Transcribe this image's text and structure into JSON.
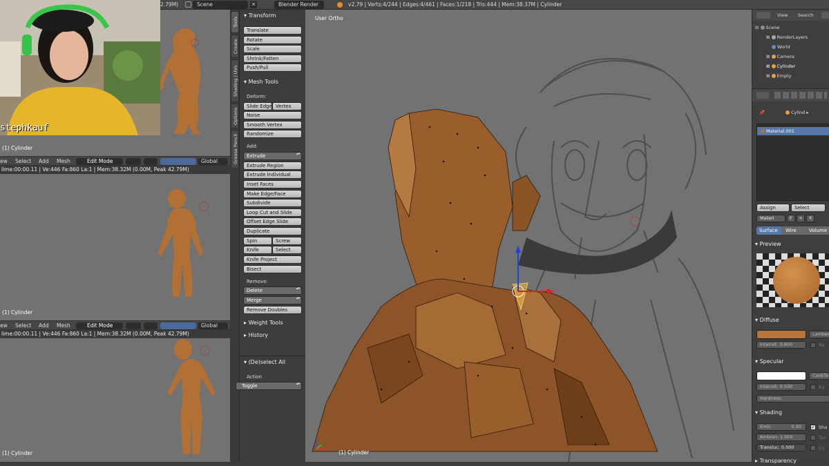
{
  "topbar": {
    "mem_left": "2.79M)",
    "scene": "Scene",
    "engine": "Blender Render",
    "stats": "v2.79 | Verts:4/244 | Edges:4/461 | Faces:1/218 | Tris:444 | Mem:38.37M | Cylinder"
  },
  "webcam": {
    "streamer": "stephkauf"
  },
  "viewports": [
    {
      "label": "(1) Cylinder"
    },
    {
      "info": "lime:00:00.11 | Ve:446 Fa:860 La:1 | Mem:38.32M (0.00M, Peak 42.79M)",
      "label": "(1) Cylinder"
    },
    {
      "info": "lime:00:00.11 | Ve:446 Fa:860 La:1 | Mem:38.32M (0.00M, Peak 42.79M)",
      "label": "(1) Cylinder"
    }
  ],
  "viewheader": {
    "view": "ew",
    "select": "Select",
    "add": "Add",
    "mesh": "Mesh",
    "mode": "Edit Mode",
    "orientation": "Global"
  },
  "tabs": [
    "Tools",
    "Create",
    "Shading / UVs",
    "Options",
    "Grease Pencil"
  ],
  "toolshelf": {
    "transform_header": "Transform",
    "transform": [
      "Translate",
      "Rotate",
      "Scale",
      "Shrink/Fatten",
      "Push/Pull"
    ],
    "meshtools_header": "Mesh Tools",
    "deform_label": "Deform:",
    "slide_edge": "Slide Edge",
    "vertex": "Vertex",
    "noise": "Noise",
    "smooth_vertex": "Smooth Vertex",
    "randomize": "Randomize",
    "add_label": "Add:",
    "extrude": "Extrude",
    "add_buttons": [
      "Extrude Region",
      "Extrude Individual",
      "Inset Faces",
      "Make Edge/Face",
      "Subdivide",
      "Loop Cut and Slide",
      "Offset Edge Slide",
      "Duplicate"
    ],
    "spin": "Spin",
    "screw": "Screw",
    "knife": "Knife",
    "select": "Select",
    "knife_project": "Knife Project",
    "bisect": "Bisect",
    "remove_label": "Remove:",
    "delete": "Delete",
    "merge": "Merge",
    "remove_doubles": "Remove Doubles",
    "weight_tools": "Weight Tools",
    "history": "History",
    "operator_header": "(De)select All",
    "action_label": "Action",
    "action_value": "Toggle"
  },
  "mainview": {
    "title": "User Ortho",
    "object_label": "(1) Cylinder"
  },
  "outliner": {
    "view": "View",
    "search": "Search",
    "items": [
      "Scene",
      "RenderLayers",
      "World",
      "Camera",
      "Cylinder",
      "Empty"
    ]
  },
  "properties": {
    "breadcrumb": "Cylind",
    "material_slot": "Material.001",
    "assign": "Assign",
    "select": "Select",
    "material_name": "Materi",
    "f": "F",
    "tabs": [
      "Surface",
      "Wire",
      "Volume"
    ],
    "preview": "Preview",
    "diffuse": "Diffuse",
    "diffuse_shader": "Lamber",
    "diffuse_intensity": "Intensit: 0.800",
    "ramp1": "Ra",
    "specular": "Specular",
    "specular_shader": "CookTo",
    "specular_intensity": "Intensit: 0.500",
    "ramp2": "Ra",
    "hardness": "Hardness:",
    "shading": "Shading",
    "emit": "Emit:",
    "emit_val": "0.00",
    "ambient": "Ambien: 1.000",
    "transluc": "Transluc: 0.000",
    "sha": "Sha",
    "tan": "Tan",
    "cu": "Cu",
    "transparency": "Transparency",
    "diffuse_color": "#b8743a",
    "specular_color": "#ffffff",
    "surface_active": "Surface"
  }
}
